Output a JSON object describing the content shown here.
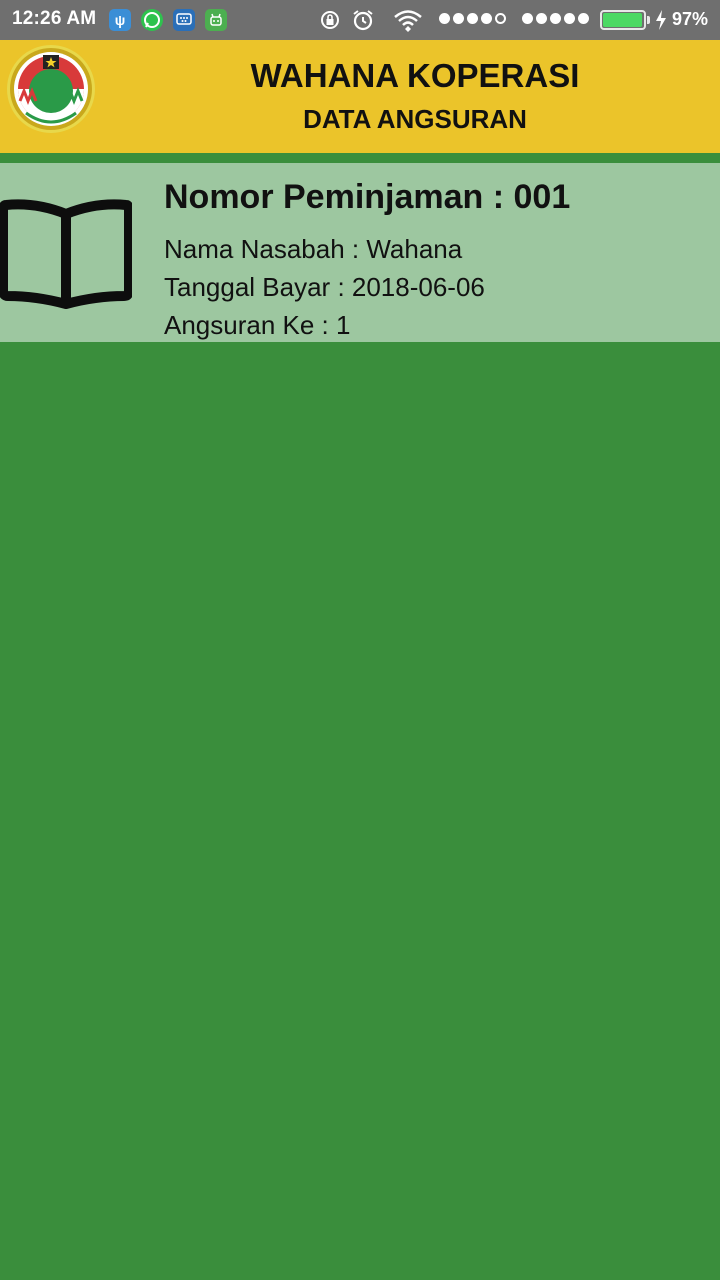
{
  "status_bar": {
    "time": "12:26 AM",
    "battery_percent": "97%",
    "battery_level": 0.97,
    "notification_icons": [
      "usb-icon",
      "whatsapp-icon",
      "bbm-icon",
      "android-icon"
    ],
    "system_icons": [
      "rotation-lock-icon",
      "alarm-icon",
      "wifi-icon",
      "signal-1-icon",
      "signal-2-icon",
      "charging-icon"
    ]
  },
  "header": {
    "title": "WAHANA KOPERASI",
    "subtitle": "DATA ANGSURAN",
    "background_color": "#ebc42a"
  },
  "list": {
    "items": [
      {
        "title": "Nomor Peminjaman : 001",
        "nama_nasabah": "Nama Nasabah : Wahana",
        "tanggal_bayar": "Tanggal Bayar : 2018-06-06",
        "angsuran_ke": "Angsuran Ke : 1",
        "icon": "book-icon"
      }
    ]
  },
  "colors": {
    "page_background": "#3a8e3c",
    "item_background": "#9dc7a0",
    "status_bar": "#6f6f6f"
  }
}
